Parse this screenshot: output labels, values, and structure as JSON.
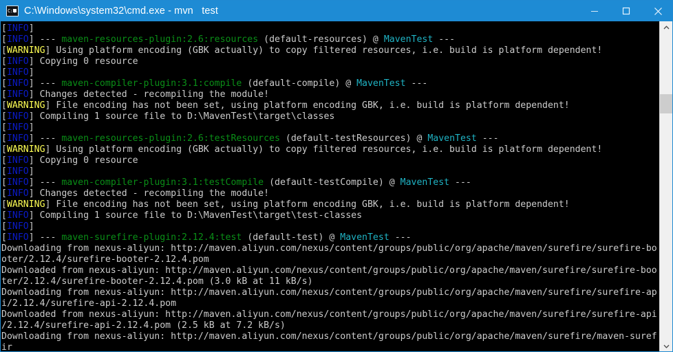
{
  "window": {
    "title": "C:\\Windows\\system32\\cmd.exe - mvn   test",
    "icon": "cmd-console-icon",
    "titlebar_color": "#1e8bd4",
    "background_color": "#000000"
  },
  "controls": {
    "minimize_label": "Minimize",
    "maximize_label": "Maximize",
    "close_label": "Close"
  },
  "scrollbar": {
    "up_arrow": "chevron-up-icon",
    "down_arrow": "chevron-down-icon",
    "thumb_position_percent": 21
  },
  "colors": {
    "info": "#0b1bc8",
    "warning": "#ffff55",
    "plugin": "#0a8f17",
    "project": "#1fb3c4",
    "text": "#cccccc",
    "accent": "#1e8bd4"
  },
  "console": {
    "lines": [
      [
        {
          "t": "[",
          "c": "white"
        },
        {
          "t": "INFO",
          "c": "blue"
        },
        {
          "t": "] ",
          "c": "white"
        }
      ],
      [
        {
          "t": "[",
          "c": "white"
        },
        {
          "t": "INFO",
          "c": "blue"
        },
        {
          "t": "] --- ",
          "c": "white"
        },
        {
          "t": "maven-resources-plugin:2.6:resources",
          "c": "green"
        },
        {
          "t": " (default-resources) @ ",
          "c": "white"
        },
        {
          "t": "MavenTest",
          "c": "cyan"
        },
        {
          "t": " ---",
          "c": "white"
        }
      ],
      [
        {
          "t": "[",
          "c": "white"
        },
        {
          "t": "WARNING",
          "c": "yellow"
        },
        {
          "t": "] Using platform encoding (GBK actually) to copy filtered resources, i.e. build is platform dependent!",
          "c": "white"
        }
      ],
      [
        {
          "t": "[",
          "c": "white"
        },
        {
          "t": "INFO",
          "c": "blue"
        },
        {
          "t": "] Copying 0 resource",
          "c": "white"
        }
      ],
      [
        {
          "t": "[",
          "c": "white"
        },
        {
          "t": "INFO",
          "c": "blue"
        },
        {
          "t": "] ",
          "c": "white"
        }
      ],
      [
        {
          "t": "[",
          "c": "white"
        },
        {
          "t": "INFO",
          "c": "blue"
        },
        {
          "t": "] --- ",
          "c": "white"
        },
        {
          "t": "maven-compiler-plugin:3.1:compile",
          "c": "green"
        },
        {
          "t": " (default-compile) @ ",
          "c": "white"
        },
        {
          "t": "MavenTest",
          "c": "cyan"
        },
        {
          "t": " ---",
          "c": "white"
        }
      ],
      [
        {
          "t": "[",
          "c": "white"
        },
        {
          "t": "INFO",
          "c": "blue"
        },
        {
          "t": "] Changes detected - recompiling the module!",
          "c": "white"
        }
      ],
      [
        {
          "t": "[",
          "c": "white"
        },
        {
          "t": "WARNING",
          "c": "yellow"
        },
        {
          "t": "] File encoding has not been set, using platform encoding GBK, i.e. build is platform dependent!",
          "c": "white"
        }
      ],
      [
        {
          "t": "[",
          "c": "white"
        },
        {
          "t": "INFO",
          "c": "blue"
        },
        {
          "t": "] Compiling 1 source file to D:\\MavenTest\\target\\classes",
          "c": "white"
        }
      ],
      [
        {
          "t": "[",
          "c": "white"
        },
        {
          "t": "INFO",
          "c": "blue"
        },
        {
          "t": "] ",
          "c": "white"
        }
      ],
      [
        {
          "t": "[",
          "c": "white"
        },
        {
          "t": "INFO",
          "c": "blue"
        },
        {
          "t": "] --- ",
          "c": "white"
        },
        {
          "t": "maven-resources-plugin:2.6:testResources",
          "c": "green"
        },
        {
          "t": " (default-testResources) @ ",
          "c": "white"
        },
        {
          "t": "MavenTest",
          "c": "cyan"
        },
        {
          "t": " ---",
          "c": "white"
        }
      ],
      [
        {
          "t": "[",
          "c": "white"
        },
        {
          "t": "WARNING",
          "c": "yellow"
        },
        {
          "t": "] Using platform encoding (GBK actually) to copy filtered resources, i.e. build is platform dependent!",
          "c": "white"
        }
      ],
      [
        {
          "t": "[",
          "c": "white"
        },
        {
          "t": "INFO",
          "c": "blue"
        },
        {
          "t": "] Copying 0 resource",
          "c": "white"
        }
      ],
      [
        {
          "t": "[",
          "c": "white"
        },
        {
          "t": "INFO",
          "c": "blue"
        },
        {
          "t": "] ",
          "c": "white"
        }
      ],
      [
        {
          "t": "[",
          "c": "white"
        },
        {
          "t": "INFO",
          "c": "blue"
        },
        {
          "t": "] --- ",
          "c": "white"
        },
        {
          "t": "maven-compiler-plugin:3.1:testCompile",
          "c": "green"
        },
        {
          "t": " (default-testCompile) @ ",
          "c": "white"
        },
        {
          "t": "MavenTest",
          "c": "cyan"
        },
        {
          "t": " ---",
          "c": "white"
        }
      ],
      [
        {
          "t": "[",
          "c": "white"
        },
        {
          "t": "INFO",
          "c": "blue"
        },
        {
          "t": "] Changes detected - recompiling the module!",
          "c": "white"
        }
      ],
      [
        {
          "t": "[",
          "c": "white"
        },
        {
          "t": "WARNING",
          "c": "yellow"
        },
        {
          "t": "] File encoding has not been set, using platform encoding GBK, i.e. build is platform dependent!",
          "c": "white"
        }
      ],
      [
        {
          "t": "[",
          "c": "white"
        },
        {
          "t": "INFO",
          "c": "blue"
        },
        {
          "t": "] Compiling 1 source file to D:\\MavenTest\\target\\test-classes",
          "c": "white"
        }
      ],
      [
        {
          "t": "[",
          "c": "white"
        },
        {
          "t": "INFO",
          "c": "blue"
        },
        {
          "t": "] ",
          "c": "white"
        }
      ],
      [
        {
          "t": "[",
          "c": "white"
        },
        {
          "t": "INFO",
          "c": "blue"
        },
        {
          "t": "] --- ",
          "c": "white"
        },
        {
          "t": "maven-surefire-plugin:2.12.4:test",
          "c": "green"
        },
        {
          "t": " (default-test) @ ",
          "c": "white"
        },
        {
          "t": "MavenTest",
          "c": "cyan"
        },
        {
          "t": " ---",
          "c": "white"
        }
      ],
      [
        {
          "t": "Downloading from nexus-aliyun: http://maven.aliyun.com/nexus/content/groups/public/org/apache/maven/surefire/surefire-bo",
          "c": "white"
        }
      ],
      [
        {
          "t": "oter/2.12.4/surefire-booter-2.12.4.pom",
          "c": "white"
        }
      ],
      [
        {
          "t": "Downloaded from nexus-aliyun: http://maven.aliyun.com/nexus/content/groups/public/org/apache/maven/surefire/surefire-boo",
          "c": "white"
        }
      ],
      [
        {
          "t": "ter/2.12.4/surefire-booter-2.12.4.pom (3.0 kB at 11 kB/s)",
          "c": "white"
        }
      ],
      [
        {
          "t": "Downloading from nexus-aliyun: http://maven.aliyun.com/nexus/content/groups/public/org/apache/maven/surefire/surefire-ap",
          "c": "white"
        }
      ],
      [
        {
          "t": "i/2.12.4/surefire-api-2.12.4.pom",
          "c": "white"
        }
      ],
      [
        {
          "t": "Downloaded from nexus-aliyun: http://maven.aliyun.com/nexus/content/groups/public/org/apache/maven/surefire/surefire-api",
          "c": "white"
        }
      ],
      [
        {
          "t": "/2.12.4/surefire-api-2.12.4.pom (2.5 kB at 7.2 kB/s)",
          "c": "white"
        }
      ],
      [
        {
          "t": "Downloading from nexus-aliyun: http://maven.aliyun.com/nexus/content/groups/public/org/apache/maven/surefire/maven-suref",
          "c": "white"
        }
      ],
      [
        {
          "t": "ir",
          "c": "white"
        }
      ]
    ]
  }
}
